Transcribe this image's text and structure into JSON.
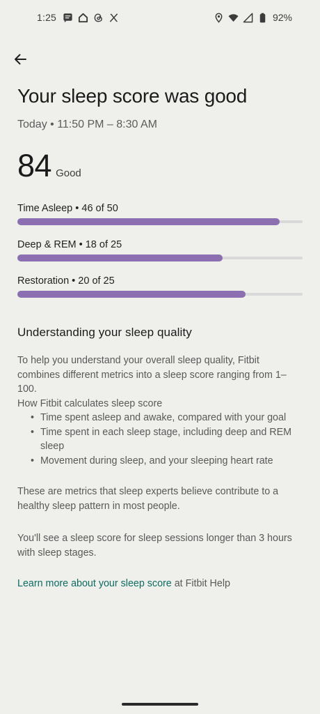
{
  "status_bar": {
    "time": "1:25",
    "battery": "92%",
    "left_icons": [
      "message-icon",
      "home-icon",
      "threads-icon",
      "x-icon"
    ],
    "right_icons": [
      "location-icon",
      "wifi-icon",
      "signal-icon",
      "battery-icon"
    ]
  },
  "header": {
    "title": "Your sleep score was good",
    "subtitle": "Today • 11:50 PM – 8:30 AM"
  },
  "score": {
    "value": "84",
    "label": "Good"
  },
  "metrics": [
    {
      "label": "Time Asleep • 46 of 50",
      "score": 46,
      "max": 50
    },
    {
      "label": "Deep & REM • 18 of 25",
      "score": 18,
      "max": 25
    },
    {
      "label": "Restoration • 20 of 25",
      "score": 20,
      "max": 25
    }
  ],
  "understanding": {
    "heading": "Understanding your sleep quality",
    "intro": "To help you understand your overall sleep quality, Fitbit combines different metrics into a sleep score ranging from 1–100.",
    "how_heading": "How Fitbit calculates sleep score",
    "bullets": [
      "Time spent asleep and awake, compared with your goal",
      "Time spent in each sleep stage, including deep and REM sleep",
      "Movement during sleep, and your sleeping heart rate"
    ],
    "metrics_note": "These are metrics that sleep experts believe contribute to a healthy sleep pattern in most people.",
    "sessions_note": "You'll see a sleep score for sleep sessions longer than 3 hours with sleep stages.",
    "learn_more_link": "Learn more about your sleep score",
    "learn_more_suffix": " at Fitbit Help"
  },
  "colors": {
    "background": "#eff0ec",
    "bar_fill": "#8b6fb0",
    "bar_track": "#d9d9d9",
    "link": "#0d6b62"
  }
}
